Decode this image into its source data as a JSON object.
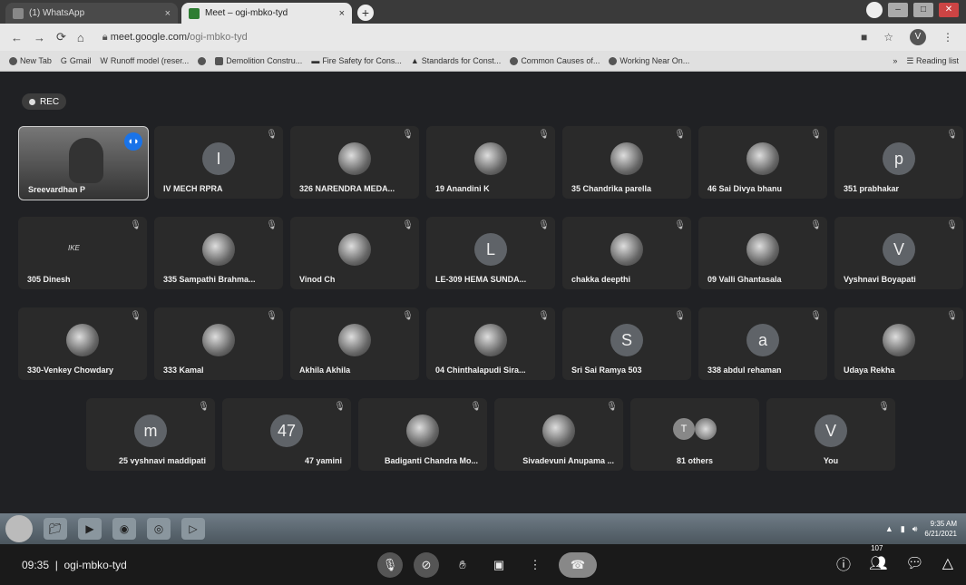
{
  "browser": {
    "tabs": [
      {
        "label": "(1) WhatsApp",
        "close": "×"
      },
      {
        "label": "Meet – ogi-mbko-tyd",
        "close": "×"
      }
    ],
    "new_tab": "+",
    "url_domain": "meet.google.com/",
    "url_path": "ogi-mbko-tyd",
    "profile_initial": "V",
    "bookmarks": [
      "New Tab",
      "Gmail",
      "Runoff model (reser...",
      "Demolition Constru...",
      "Fire Safety for Cons...",
      "Standards for Const...",
      "Common Causes of...",
      "Working Near On..."
    ],
    "reading_list": "Reading list",
    "more": "»"
  },
  "meet": {
    "rec_label": "REC",
    "participants": [
      {
        "name": "Sreevardhan P",
        "kind": "video"
      },
      {
        "name": "IV MECH RPRA",
        "kind": "letter",
        "initial": "I"
      },
      {
        "name": "326 NARENDRA MEDA...",
        "kind": "photo"
      },
      {
        "name": "19 Anandini K",
        "kind": "photo"
      },
      {
        "name": "35 Chandrika parella",
        "kind": "photo"
      },
      {
        "name": "46 Sai Divya bhanu",
        "kind": "photo"
      },
      {
        "name": "351 prabhakar",
        "kind": "letter",
        "initial": "p"
      },
      {
        "name": "305 Dinesh",
        "kind": "none"
      },
      {
        "name": "335 Sampathi Brahma...",
        "kind": "photo"
      },
      {
        "name": "Vinod Ch",
        "kind": "photo"
      },
      {
        "name": "LE-309 HEMA SUNDA...",
        "kind": "letter",
        "initial": "L"
      },
      {
        "name": "chakka deepthi",
        "kind": "photo"
      },
      {
        "name": "09 Valli Ghantasala",
        "kind": "photo"
      },
      {
        "name": "Vyshnavi Boyapati",
        "kind": "letter",
        "initial": "V"
      },
      {
        "name": "330-Venkey Chowdary",
        "kind": "photo"
      },
      {
        "name": "333 Kamal",
        "kind": "photo"
      },
      {
        "name": "Akhila Akhila",
        "kind": "photo"
      },
      {
        "name": "04 Chinthalapudi Sira...",
        "kind": "photo"
      },
      {
        "name": "Sri Sai Ramya 503",
        "kind": "letter",
        "initial": "S"
      },
      {
        "name": "338 abdul rehaman",
        "kind": "letter",
        "initial": "a"
      },
      {
        "name": "Udaya Rekha",
        "kind": "photo"
      },
      {
        "name": "25 vyshnavi maddipati",
        "kind": "letter",
        "initial": "m"
      },
      {
        "name": "47 yamini",
        "kind": "letter",
        "initial": "47"
      },
      {
        "name": "Badiganti Chandra Mo...",
        "kind": "photo"
      },
      {
        "name": "Sivadevuni Anupama ...",
        "kind": "photo"
      },
      {
        "name": "81 others",
        "kind": "others",
        "initial": "T"
      },
      {
        "name": "You",
        "kind": "letter",
        "initial": "V"
      }
    ],
    "dinesh_overlay": "IKE",
    "meeting_time": "09:35",
    "meeting_code": "ogi-mbko-tyd",
    "participant_count": "107"
  },
  "taskbar": {
    "time": "9:35 AM",
    "date": "6/21/2021"
  },
  "colors": {
    "accent": "#1a73e8",
    "meet_bg": "#202124",
    "tile_bg": "#2a2a2a"
  }
}
